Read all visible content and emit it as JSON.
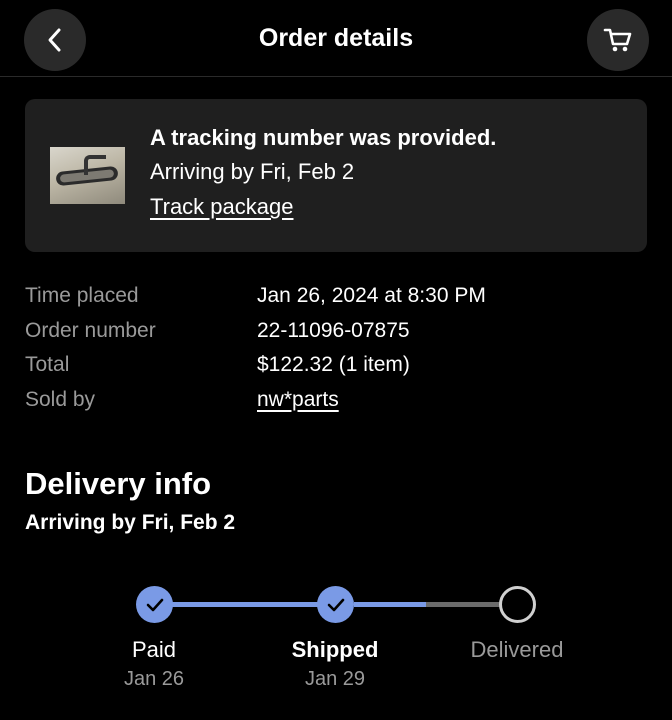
{
  "header": {
    "title": "Order details",
    "back_icon": "chevron-left-icon",
    "cart_icon": "shopping-cart-icon"
  },
  "tracking_card": {
    "heading": "A tracking number was provided.",
    "arrival": "Arriving by Fri, Feb 2",
    "link": "Track package"
  },
  "order": {
    "time_placed_label": "Time placed",
    "time_placed_value": "Jan 26, 2024 at 8:30 PM",
    "order_number_label": "Order number",
    "order_number_value": "22-11096-07875",
    "total_label": "Total",
    "total_value": "$122.32 (1 item)",
    "sold_by_label": "Sold by",
    "sold_by_value": "nw*parts"
  },
  "delivery": {
    "title": "Delivery info",
    "subtitle": "Arriving by Fri, Feb 2",
    "steps": [
      {
        "label": "Paid",
        "date": "Jan 26",
        "status": "done"
      },
      {
        "label": "Shipped",
        "date": "Jan 29",
        "status": "done"
      },
      {
        "label": "Delivered",
        "date": "",
        "status": "pending"
      }
    ],
    "progress_after_shipped": 0.45
  },
  "colors": {
    "background": "#000000",
    "card": "#1f1f1f",
    "accent": "#7a9ae6",
    "muted_text": "#9a9a9a"
  }
}
